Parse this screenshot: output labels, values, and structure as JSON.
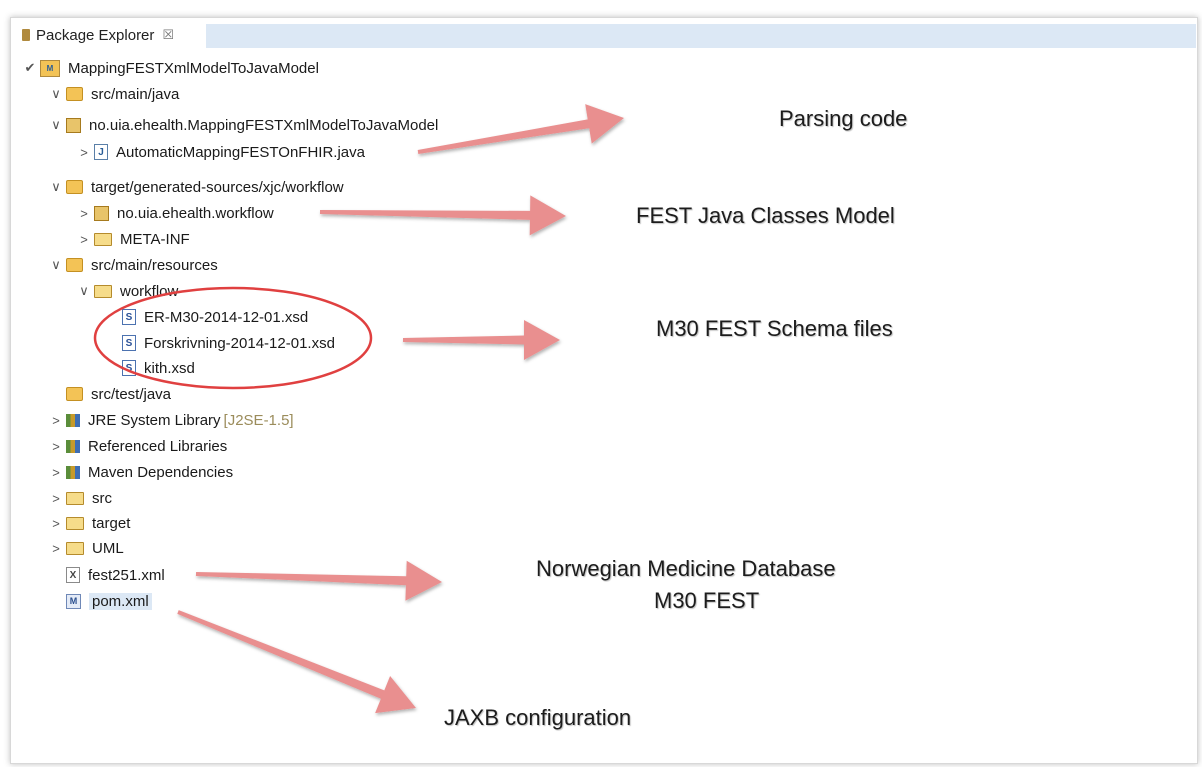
{
  "view": {
    "title": "Package Explorer",
    "close_glyph": "☒"
  },
  "tree": [
    {
      "label": "MappingFESTXmlModelToJavaModel",
      "twisty": "✔",
      "icon": "project-icon",
      "glyph": "M"
    },
    {
      "label": "src/main/java",
      "twisty": "∨",
      "icon": "source-folder-icon",
      "glyph": ""
    },
    {
      "label": "no.uia.ehealth.MappingFESTXmlModelToJavaModel",
      "twisty": "∨",
      "icon": "package-icon",
      "glyph": ""
    },
    {
      "label": "AutomaticMappingFESTOnFHIR.java",
      "twisty": ">",
      "icon": "java-file-icon",
      "glyph": "J"
    },
    {
      "label": "target/generated-sources/xjc/workflow",
      "twisty": "∨",
      "icon": "source-folder-icon",
      "glyph": ""
    },
    {
      "label": "no.uia.ehealth.workflow",
      "twisty": ">",
      "icon": "package-icon",
      "glyph": ""
    },
    {
      "label": "META-INF",
      "twisty": ">",
      "icon": "folder-icon",
      "glyph": ""
    },
    {
      "label": "src/main/resources",
      "twisty": "∨",
      "icon": "source-folder-icon",
      "glyph": ""
    },
    {
      "label": "workflow",
      "twisty": "∨",
      "icon": "folder-icon",
      "glyph": ""
    },
    {
      "label": "ER-M30-2014-12-01.xsd",
      "twisty": "",
      "icon": "xsd-file-icon",
      "glyph": "S"
    },
    {
      "label": "Forskrivning-2014-12-01.xsd",
      "twisty": "",
      "icon": "xsd-file-icon",
      "glyph": "S"
    },
    {
      "label": "kith.xsd",
      "twisty": "",
      "icon": "xsd-file-icon",
      "glyph": "S"
    },
    {
      "label": "src/test/java",
      "twisty": "",
      "icon": "source-folder-icon",
      "glyph": ""
    },
    {
      "label": "JRE System Library",
      "decoration": "[J2SE-1.5]",
      "twisty": ">",
      "icon": "library-icon",
      "glyph": ""
    },
    {
      "label": "Referenced Libraries",
      "twisty": ">",
      "icon": "library-icon",
      "glyph": ""
    },
    {
      "label": "Maven Dependencies",
      "twisty": ">",
      "icon": "library-icon",
      "glyph": ""
    },
    {
      "label": "src",
      "twisty": ">",
      "icon": "folder-icon",
      "glyph": ""
    },
    {
      "label": "target",
      "twisty": ">",
      "icon": "folder-icon",
      "glyph": ""
    },
    {
      "label": "UML",
      "twisty": ">",
      "icon": "folder-icon",
      "glyph": ""
    },
    {
      "label": "fest251.xml",
      "twisty": "",
      "icon": "xml-file-icon",
      "glyph": "X"
    },
    {
      "label": "pom.xml",
      "twisty": "",
      "icon": "pom-file-icon",
      "glyph": "M",
      "selected": true
    }
  ],
  "annotations": {
    "parsing": "Parsing code",
    "model": "FEST Java Classes Model",
    "schema": "M30 FEST Schema files",
    "database_line1": "Norwegian Medicine Database",
    "database_line2": "M30 FEST",
    "jaxb": "JAXB configuration"
  },
  "colors": {
    "arrow": "#e98f8f",
    "circle": "#e04040",
    "selection": "#dce8f5"
  }
}
